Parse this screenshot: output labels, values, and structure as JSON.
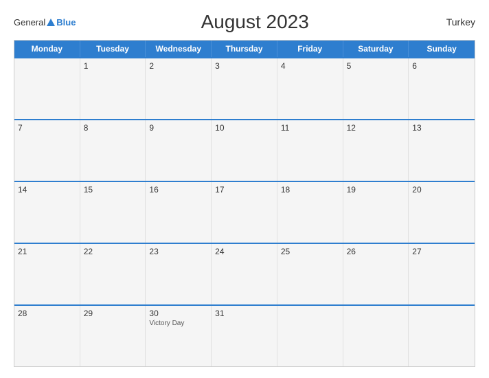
{
  "header": {
    "logo_general": "General",
    "logo_blue": "Blue",
    "title": "August 2023",
    "country": "Turkey"
  },
  "weekdays": [
    "Monday",
    "Tuesday",
    "Wednesday",
    "Thursday",
    "Friday",
    "Saturday",
    "Sunday"
  ],
  "weeks": [
    [
      {
        "day": "",
        "empty": true
      },
      {
        "day": "1"
      },
      {
        "day": "2"
      },
      {
        "day": "3"
      },
      {
        "day": "4"
      },
      {
        "day": "5"
      },
      {
        "day": "6"
      }
    ],
    [
      {
        "day": "7"
      },
      {
        "day": "8"
      },
      {
        "day": "9"
      },
      {
        "day": "10"
      },
      {
        "day": "11"
      },
      {
        "day": "12"
      },
      {
        "day": "13"
      }
    ],
    [
      {
        "day": "14"
      },
      {
        "day": "15"
      },
      {
        "day": "16"
      },
      {
        "day": "17"
      },
      {
        "day": "18"
      },
      {
        "day": "19"
      },
      {
        "day": "20"
      }
    ],
    [
      {
        "day": "21"
      },
      {
        "day": "22"
      },
      {
        "day": "23"
      },
      {
        "day": "24"
      },
      {
        "day": "25"
      },
      {
        "day": "26"
      },
      {
        "day": "27"
      }
    ],
    [
      {
        "day": "28"
      },
      {
        "day": "29"
      },
      {
        "day": "30",
        "holiday": "Victory Day"
      },
      {
        "day": "31"
      },
      {
        "day": "",
        "empty": true
      },
      {
        "day": "",
        "empty": true
      },
      {
        "day": "",
        "empty": true
      }
    ]
  ]
}
